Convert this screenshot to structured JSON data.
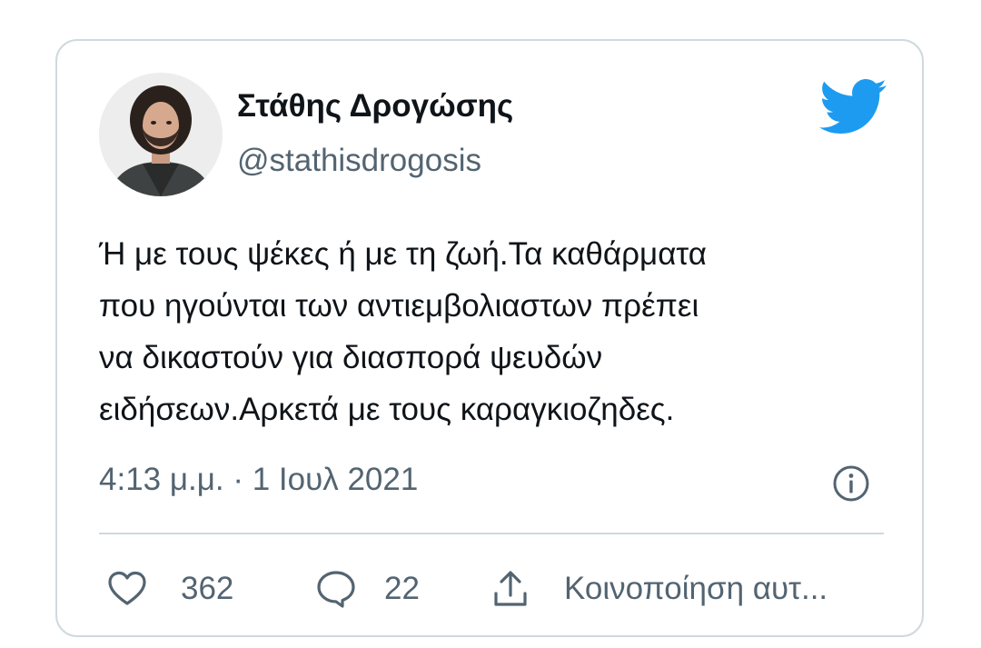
{
  "user": {
    "name": "Στάθης Δρογώσης",
    "handle": "@stathisdrogosis",
    "avatar": "profile-photo"
  },
  "icons": {
    "brand": "twitter-bird-icon",
    "info": "info-icon",
    "like": "heart-icon",
    "reply": "speech-bubble-icon",
    "share": "share-icon"
  },
  "tweet": {
    "text": "Ή με τους ψέκες ή με τη ζωή.Τα καθάρματα\nπου ηγούνται των αντιεμβολιαστων πρέπει\nνα δικαστούν για διασπορά ψευδών\nειδήσεων.Αρκετά με τους καραγκιοζηδες.",
    "timestamp": "4:13 μ.μ. · 1 Ιουλ 2021"
  },
  "actions": {
    "likes": "362",
    "replies": "22",
    "share_label": "Κοινοποίηση αυτ..."
  },
  "colors": {
    "brand": "#1d9bf0",
    "text": "#0f1419",
    "secondary": "#536471",
    "border": "#cfd9de"
  }
}
